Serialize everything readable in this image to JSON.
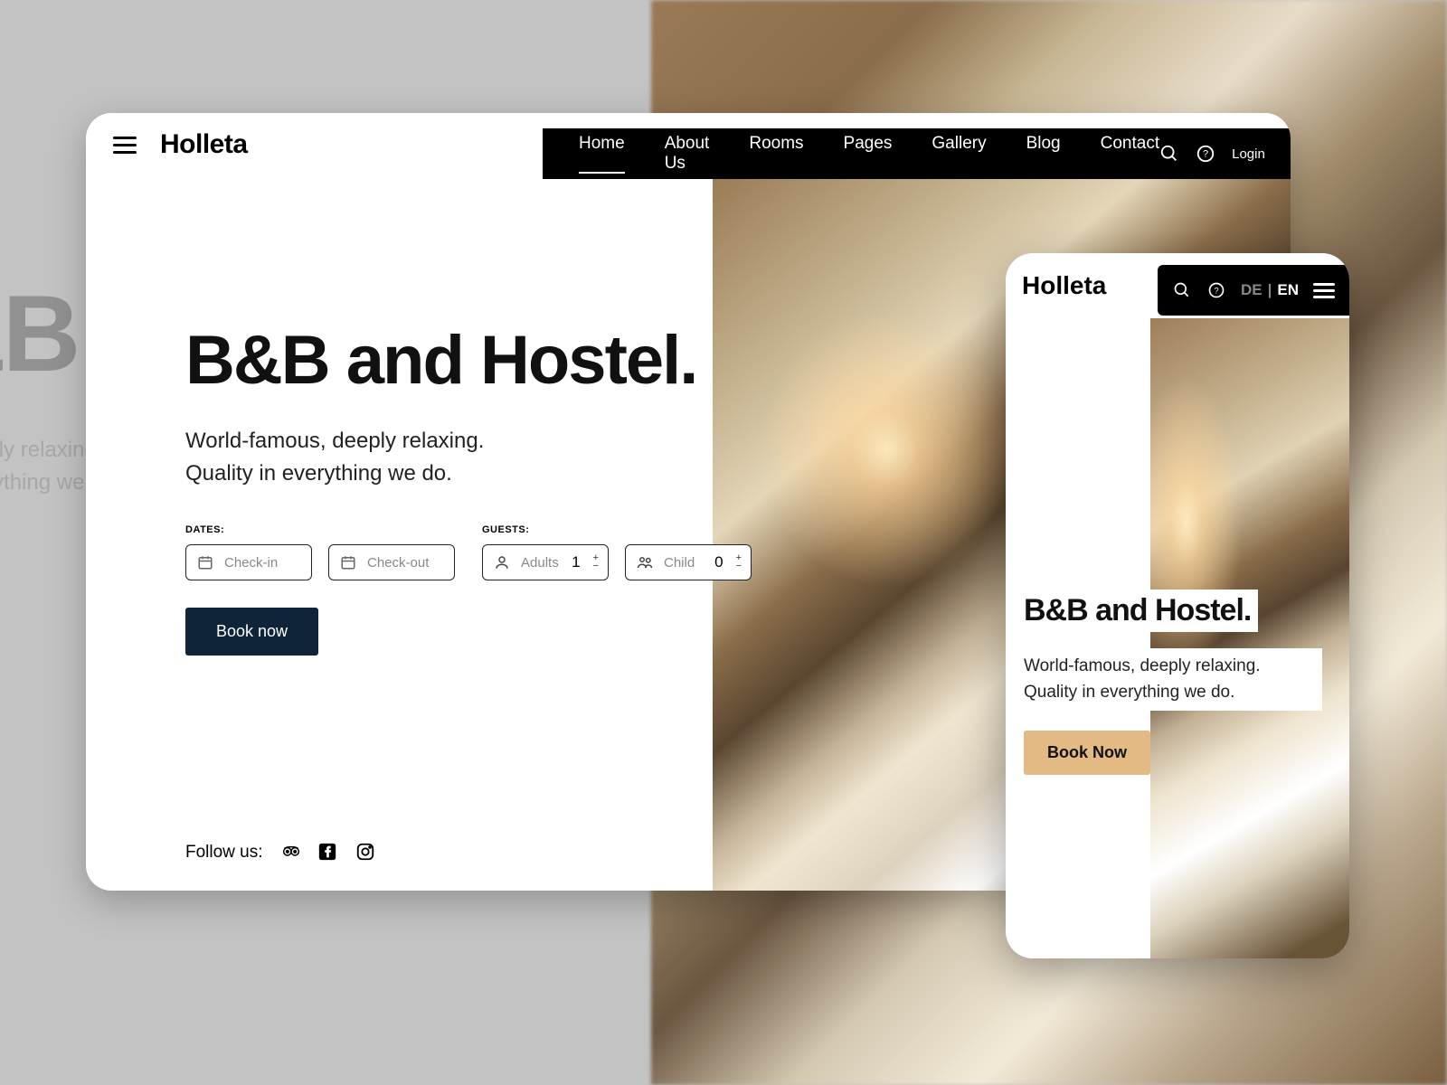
{
  "brand": "Holleta",
  "nav": {
    "items": [
      "Home",
      "About Us",
      "Rooms",
      "Pages",
      "Gallery",
      "Blog",
      "Contact"
    ],
    "active_index": 0,
    "login": "Login",
    "lang_inactive": "DE",
    "lang_active": "EN"
  },
  "hero": {
    "title": "B&B and Hostel.",
    "subtitle": "World-famous, deeply relaxing. Quality in everything we do."
  },
  "form": {
    "dates_label": "DATES:",
    "guests_label": "GUESTS:",
    "checkin_placeholder": "Check-in",
    "checkout_placeholder": "Check-out",
    "adults_label": "Adults",
    "adults_value": "1",
    "child_label": "Child",
    "child_value": "0",
    "book_label": "Book now"
  },
  "follow": {
    "label": "Follow us:"
  },
  "mobile": {
    "book_label": "Book Now"
  },
  "bg": {
    "big": "&B",
    "sub": "s, deeply relaxing. Quality in everything we do."
  }
}
